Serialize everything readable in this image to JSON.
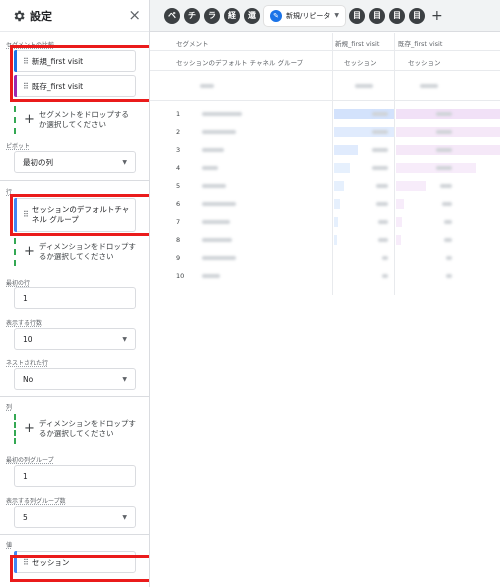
{
  "panel": {
    "title": "設定",
    "close": "×",
    "segment_compare_label": "セグメントの比較",
    "segments": [
      {
        "label": "新規_first visit",
        "color": "#1a73e8"
      },
      {
        "label": "既存_first visit",
        "color": "#9c27b0"
      }
    ],
    "segment_drop": "セグメントをドロップするか選択してください",
    "pivot_label": "ピボット",
    "pivot_value": "最初の列",
    "rows_label": "行",
    "row_dimension": "セッションのデフォルトチャネル グループ",
    "row_dimension_color": "#4285f4",
    "dimension_drop": "ディメンションをドロップするか選択してください",
    "first_row_label": "最初の行",
    "first_row_value": "1",
    "rows_shown_label": "表示する行数",
    "rows_shown_value": "10",
    "nested_rows_label": "ネストされた行",
    "nested_rows_value": "No",
    "columns_label": "列",
    "column_drop": "ディメンションをドロップするか選択してください",
    "first_col_group_label": "最初の列グループ",
    "first_col_group_value": "1",
    "col_groups_shown_label": "表示する列グループ数",
    "col_groups_shown_value": "5",
    "values_label": "値",
    "metric": "セッション",
    "metric_color": "#4285f4"
  },
  "tabs": {
    "icons": [
      "ペ",
      "チ",
      "ラ",
      "経",
      "還"
    ],
    "active_label": "新規/リピータ",
    "after_icons": [
      "目",
      "目",
      "目",
      "目"
    ],
    "plus": "+"
  },
  "table": {
    "col_segment": "セグメント",
    "seg_new": "新規_first visit",
    "seg_existing": "既存_first visit",
    "dimension_header": "セッションのデフォルト チャネル グループ",
    "metric_new": "セッション",
    "metric_existing": "セッション",
    "row_numbers": [
      "1",
      "2",
      "3",
      "4",
      "5",
      "6",
      "7",
      "8",
      "9",
      "10"
    ]
  },
  "colors": {
    "highlight": "#ea1b1b",
    "accent_blue": "#1a73e8",
    "accent_purple": "#9c27b0",
    "drop_green": "#34a853"
  }
}
